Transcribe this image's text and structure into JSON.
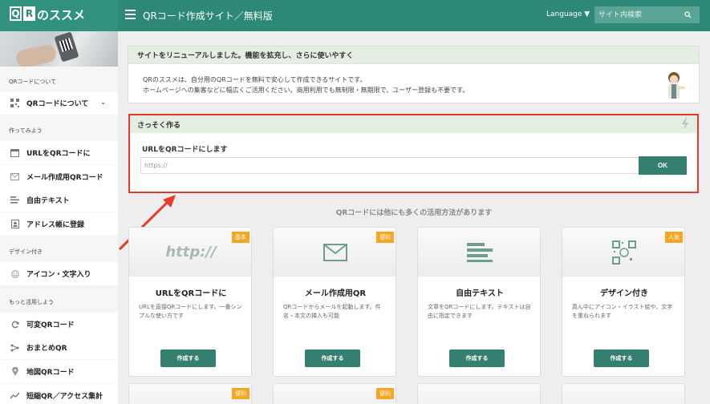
{
  "header": {
    "logo": {
      "letter1": "Q",
      "letter2": "R",
      "text": "のススメ"
    },
    "site_title": "QRコード作成サイト／無料版",
    "language_label": "Language ▼",
    "search_placeholder": "サイト内検索"
  },
  "sidebar": {
    "sections": [
      {
        "label": "QRコードについて"
      },
      {
        "label": "作ってみよう"
      },
      {
        "label": "デザイン付き"
      },
      {
        "label": "もっと活用しよう"
      }
    ],
    "items": [
      {
        "label": "QRコードについて",
        "icon": "qr-icon",
        "chevron": "⌄"
      },
      {
        "label": "URLをQRコードに",
        "icon": "browser-icon"
      },
      {
        "label": "メール作成用QRコード",
        "icon": "mail-icon"
      },
      {
        "label": "自由テキスト",
        "icon": "text-icon"
      },
      {
        "label": "アドレス帳に登録",
        "icon": "contact-icon"
      },
      {
        "label": "アイコン・文字入り",
        "icon": "smile-icon"
      },
      {
        "label": "可変QRコード",
        "icon": "refresh-icon"
      },
      {
        "label": "おまとめQR",
        "icon": "branch-icon"
      },
      {
        "label": "地図QRコード",
        "icon": "pin-icon"
      },
      {
        "label": "短縮QR／アクセス集計",
        "icon": "chart-icon"
      }
    ]
  },
  "notice": {
    "title": "サイトをリニューアルしました。機能を拡充し、さらに使いやすく",
    "line1": "QRのススメは、自分用のQRコードを無料で安心して作成できるサイトです。",
    "line2": "ホームページへの集客などに幅広くご活用ください。商用利用でも無制限・無期限で、ユーザー登録も不要です。"
  },
  "quick": {
    "title": "さっそく作る",
    "label": "URLをQRコードにします",
    "placeholder": "https://",
    "ok_label": "OK"
  },
  "subheading": "QRコードには他にも多くの活用方法があります",
  "cards": [
    {
      "badge": "基本",
      "image_text": "http://",
      "title": "URLをQRコードに",
      "desc": "URLを直接QRコードにします。一番シンプルな使い方です",
      "button": "作成する"
    },
    {
      "badge": "便利",
      "icon": "mail-icon",
      "title": "メール作成用QR",
      "desc": "QRコードからメールを起動します。件名・本文の挿入も可能",
      "button": "作成する"
    },
    {
      "badge": "",
      "icon": "text-icon",
      "title": "自由テキスト",
      "desc": "文章をQRコードにします。テキストは自由に指定できます",
      "button": "作成する"
    },
    {
      "badge": "人気",
      "icon": "qr-smile-icon",
      "title": "デザイン付き",
      "desc": "真ん中にアイコン・イラスト絵や、文字を重ねられます",
      "button": "作成する"
    }
  ],
  "cards_row2": [
    {
      "badge": "便利"
    },
    {
      "badge": "便利"
    },
    {
      "badge": ""
    },
    {
      "badge": ""
    }
  ],
  "colors": {
    "primary": "#2d8877",
    "button": "#357f70",
    "badge": "#f6a623",
    "highlight": "#e73a2b"
  }
}
